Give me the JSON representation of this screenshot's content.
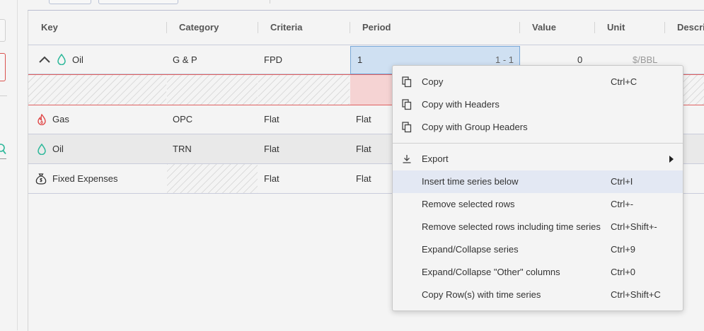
{
  "colors": {
    "oil_icon": "#2db89a",
    "gas_icon": "#e04848",
    "selection": "#cfe0f2",
    "error_row": "#f5d3d3",
    "menu_highlight": "#e3e8f3"
  },
  "columns": [
    "Key",
    "Category",
    "Criteria",
    "Period",
    "Value",
    "Unit",
    "Descri"
  ],
  "rows": [
    {
      "key": "Oil",
      "icon": "oil-drop-icon",
      "category": "G & P",
      "criteria": "FPD",
      "period": "1",
      "period_range": "1 - 1",
      "value": "0",
      "unit": "$/BBL"
    },
    {
      "key": "",
      "icon": "",
      "category": "",
      "criteria": "",
      "period": "",
      "value": "",
      "unit": ""
    },
    {
      "key": "Gas",
      "icon": "gas-flame-icon",
      "category": "OPC",
      "criteria": "Flat",
      "period": "Flat"
    },
    {
      "key": "Oil",
      "icon": "oil-drop-icon",
      "category": "TRN",
      "criteria": "Flat",
      "period": "Flat"
    },
    {
      "key": "Fixed Expenses",
      "icon": "money-bag-icon",
      "category": "",
      "criteria": "Flat",
      "period": "Flat"
    }
  ],
  "menu": {
    "items": [
      {
        "label": "Copy",
        "shortcut": "Ctrl+C",
        "icon": "copy-icon"
      },
      {
        "label": "Copy with Headers",
        "shortcut": "",
        "icon": "copy-icon"
      },
      {
        "label": "Copy with Group Headers",
        "shortcut": "",
        "icon": "copy-icon"
      },
      {
        "label": "Export",
        "shortcut": "",
        "icon": "download-icon"
      },
      {
        "label": "Insert time series below",
        "shortcut": "Ctrl+I",
        "icon": ""
      },
      {
        "label": "Remove selected rows",
        "shortcut": "Ctrl+-",
        "icon": ""
      },
      {
        "label": "Remove selected rows including time series",
        "shortcut": "Ctrl+Shift+-",
        "icon": ""
      },
      {
        "label": "Expand/Collapse series",
        "shortcut": "Ctrl+9",
        "icon": ""
      },
      {
        "label": "Expand/Collapse \"Other\" columns",
        "shortcut": "Ctrl+0",
        "icon": ""
      },
      {
        "label": "Copy Row(s) with time series",
        "shortcut": "Ctrl+Shift+C",
        "icon": ""
      }
    ]
  }
}
